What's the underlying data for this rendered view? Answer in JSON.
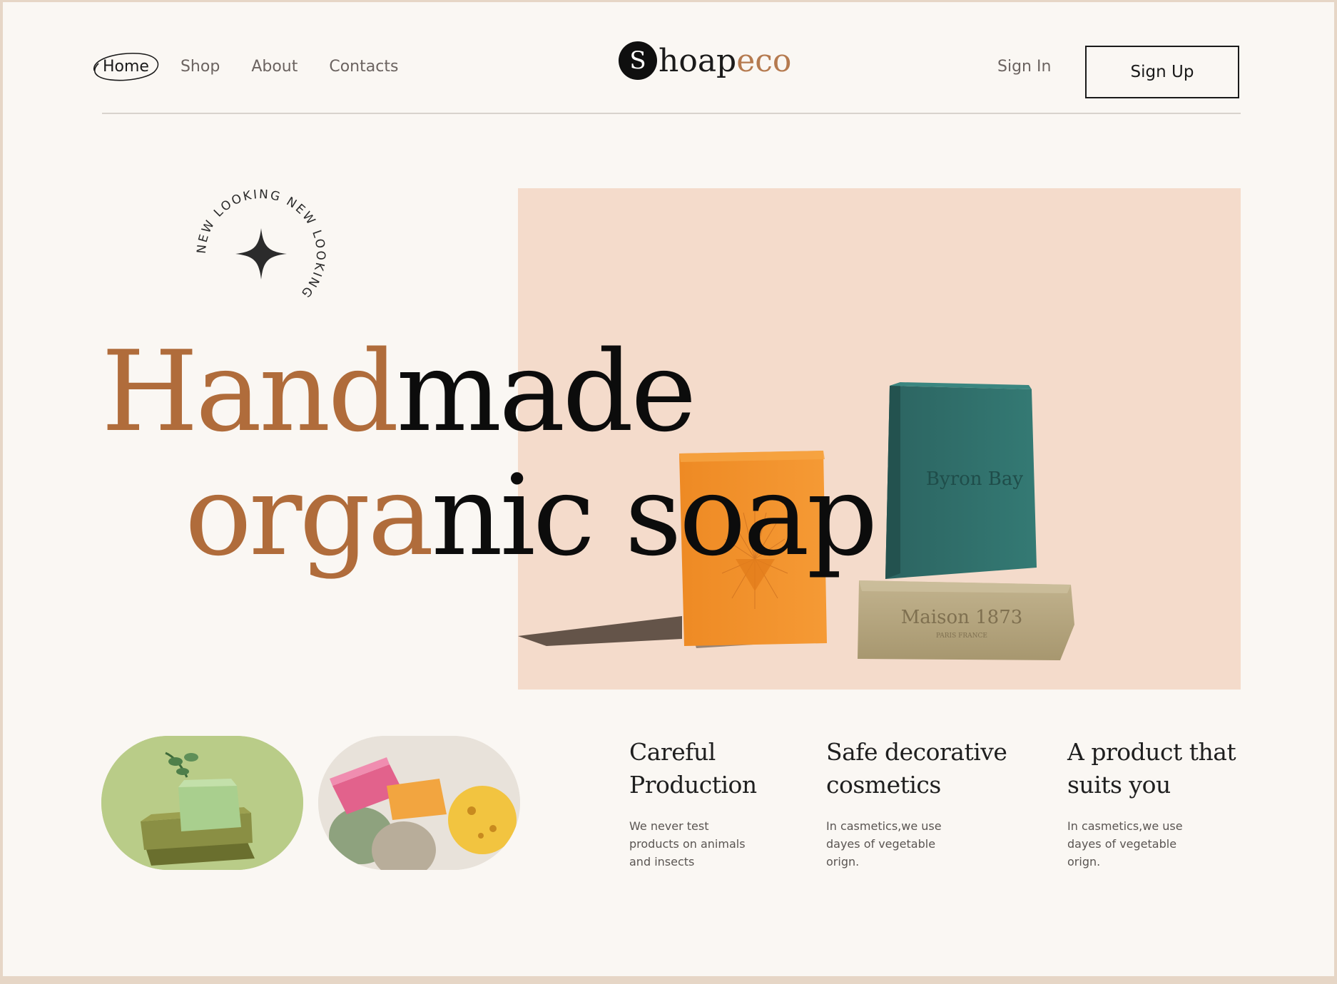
{
  "header": {
    "nav": [
      {
        "label": "Home",
        "active": true
      },
      {
        "label": "Shop"
      },
      {
        "label": "About"
      },
      {
        "label": "Contacts"
      }
    ],
    "logo": {
      "mark": "S",
      "text_dark": "hoap",
      "text_accent": "eco"
    },
    "sign_in": "Sign In",
    "sign_up": "Sign Up"
  },
  "hero": {
    "badge_text": "NEW LOOKING NEW LOOKING",
    "title_line1_accent": "Hand",
    "title_line1_rest": "made",
    "title_line2_accent": "orga",
    "title_line2_rest": "nic soap",
    "soap_labels": {
      "green": "Byron Bay",
      "beige": "Maison 1873",
      "beige_sub": "PARIS FRANCE"
    }
  },
  "features": [
    {
      "title_l1": "Careful",
      "title_l2": "Production",
      "text": "We never test products on animals and insects"
    },
    {
      "title_l1": "Safe decorative",
      "title_l2": "cosmetics",
      "text": "In casmetics,we use dayes of vegetable orign."
    },
    {
      "title_l1": "A product that",
      "title_l2": "suits you",
      "text": "In casmetics,we use dayes of vegetable orign."
    }
  ],
  "colors": {
    "accent": "#b06c3b",
    "panel": "#f4dbcb",
    "background": "#faf7f3",
    "soap_orange": "#f0902a",
    "soap_green": "#2f6e6a",
    "soap_beige": "#b1a17e"
  },
  "icons": [
    "sparkle-star-icon"
  ]
}
